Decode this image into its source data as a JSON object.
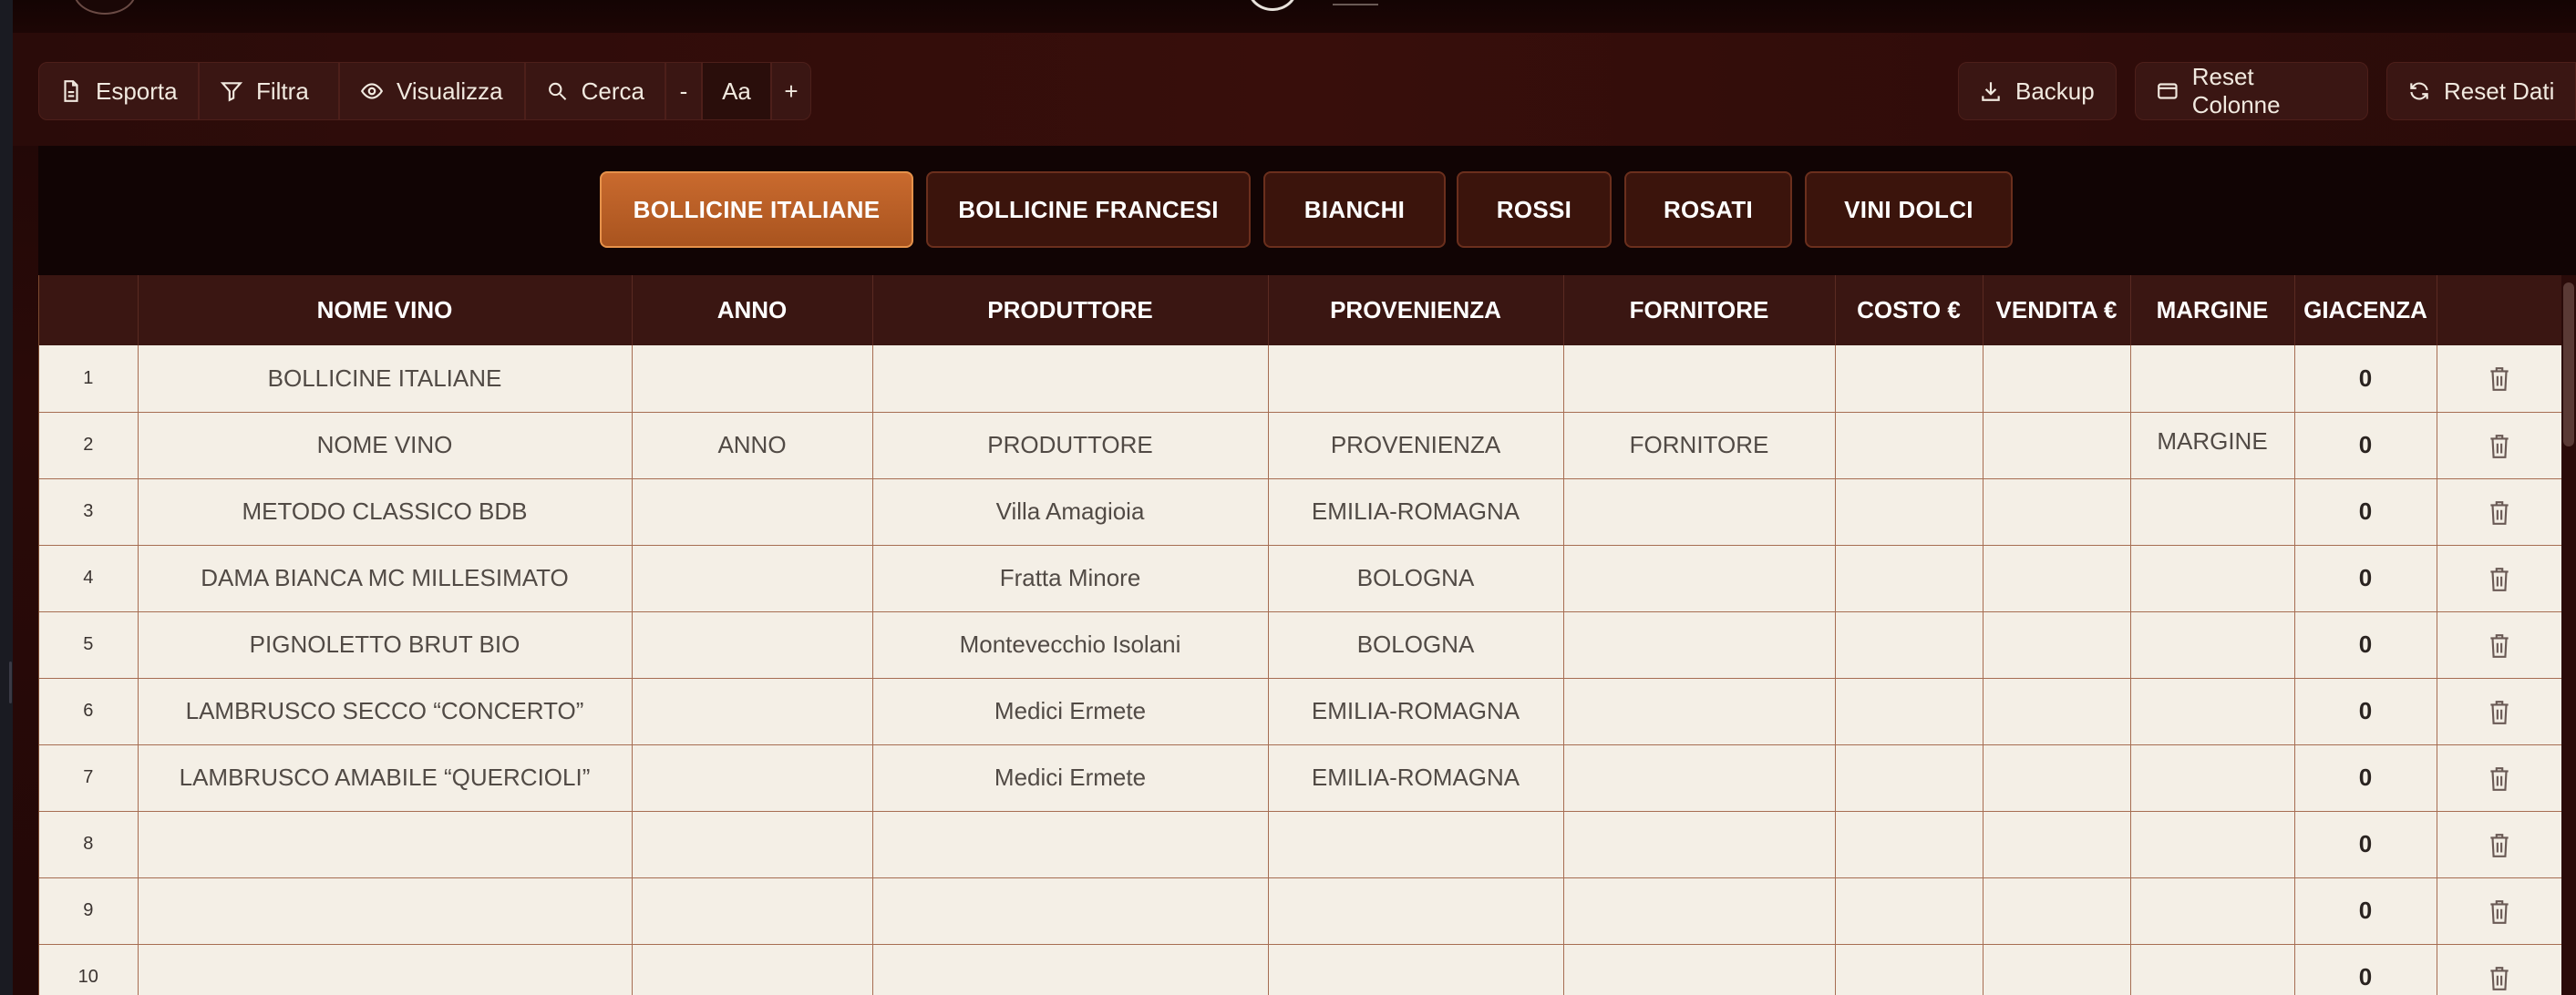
{
  "toolbar": {
    "export_label": "Esporta",
    "filter_label": "Filtra",
    "view_label": "Visualizza",
    "search_label": "Cerca",
    "font_decrease_label": "-",
    "font_label": "Aa",
    "font_increase_label": "+",
    "backup_label": "Backup",
    "reset_columns_label": "Reset Colonne",
    "reset_data_label": "Reset Dati"
  },
  "tabs": [
    {
      "label": "BOLLICINE ITALIANE",
      "active": true
    },
    {
      "label": "BOLLICINE FRANCESI",
      "active": false
    },
    {
      "label": "BIANCHI",
      "active": false
    },
    {
      "label": "ROSSI",
      "active": false
    },
    {
      "label": "ROSATI",
      "active": false
    },
    {
      "label": "VINI DOLCI",
      "active": false
    }
  ],
  "table": {
    "columns": [
      "",
      "NOME VINO",
      "ANNO",
      "PRODUTTORE",
      "PROVENIENZA",
      "FORNITORE",
      "COSTO €",
      "VENDITA €",
      "MARGINE",
      "GIACENZA",
      ""
    ],
    "rows": [
      {
        "n": "1",
        "nome": "BOLLICINE ITALIANE",
        "anno": "",
        "produttore": "",
        "provenienza": "",
        "fornitore": "",
        "costo": "",
        "vendita": "",
        "margine": "",
        "giacenza": "0"
      },
      {
        "n": "2",
        "nome": "NOME VINO",
        "anno": "ANNO",
        "produttore": "PRODUTTORE",
        "provenienza": "PROVENIENZA",
        "fornitore": "FORNITORE",
        "costo": "",
        "vendita": "",
        "margine": "MARGINE",
        "giacenza": "0"
      },
      {
        "n": "3",
        "nome": "METODO CLASSICO BDB",
        "anno": "",
        "produttore": "Villa Amagioia",
        "provenienza": "EMILIA-ROMAGNA",
        "fornitore": "",
        "costo": "",
        "vendita": "",
        "margine": "",
        "giacenza": "0"
      },
      {
        "n": "4",
        "nome": "DAMA BIANCA MC MILLESIMATO",
        "anno": "",
        "produttore": "Fratta Minore",
        "provenienza": "BOLOGNA",
        "fornitore": "",
        "costo": "",
        "vendita": "",
        "margine": "",
        "giacenza": "0"
      },
      {
        "n": "5",
        "nome": "PIGNOLETTO BRUT BIO",
        "anno": "",
        "produttore": "Montevecchio Isolani",
        "provenienza": "BOLOGNA",
        "fornitore": "",
        "costo": "",
        "vendita": "",
        "margine": "",
        "giacenza": "0"
      },
      {
        "n": "6",
        "nome": "LAMBRUSCO SECCO “CONCERTO”",
        "anno": "",
        "produttore": "Medici Ermete",
        "provenienza": "EMILIA-ROMAGNA",
        "fornitore": "",
        "costo": "",
        "vendita": "",
        "margine": "",
        "giacenza": "0"
      },
      {
        "n": "7",
        "nome": "LAMBRUSCO AMABILE “QUERCIOLI”",
        "anno": "",
        "produttore": "Medici Ermete",
        "provenienza": "EMILIA-ROMAGNA",
        "fornitore": "",
        "costo": "",
        "vendita": "",
        "margine": "",
        "giacenza": "0"
      },
      {
        "n": "8",
        "nome": "",
        "anno": "",
        "produttore": "",
        "provenienza": "",
        "fornitore": "",
        "costo": "",
        "vendita": "",
        "margine": "",
        "giacenza": "0"
      },
      {
        "n": "9",
        "nome": "",
        "anno": "",
        "produttore": "",
        "provenienza": "",
        "fornitore": "",
        "costo": "",
        "vendita": "",
        "margine": "",
        "giacenza": "0"
      },
      {
        "n": "10",
        "nome": "",
        "anno": "",
        "produttore": "",
        "provenienza": "",
        "fornitore": "",
        "costo": "",
        "vendita": "",
        "margine": "",
        "giacenza": "0"
      }
    ]
  },
  "icons": {
    "export": "file-export-icon",
    "filter": "funnel-icon",
    "view": "eye-icon",
    "search": "search-icon",
    "backup": "download-icon",
    "reset_columns": "columns-icon",
    "reset_data": "refresh-icon",
    "row_delete": "trash-icon"
  },
  "colors": {
    "accent": "#c96a2e",
    "header_bg": "#3a1612",
    "row_bg": "#f4efe6"
  }
}
